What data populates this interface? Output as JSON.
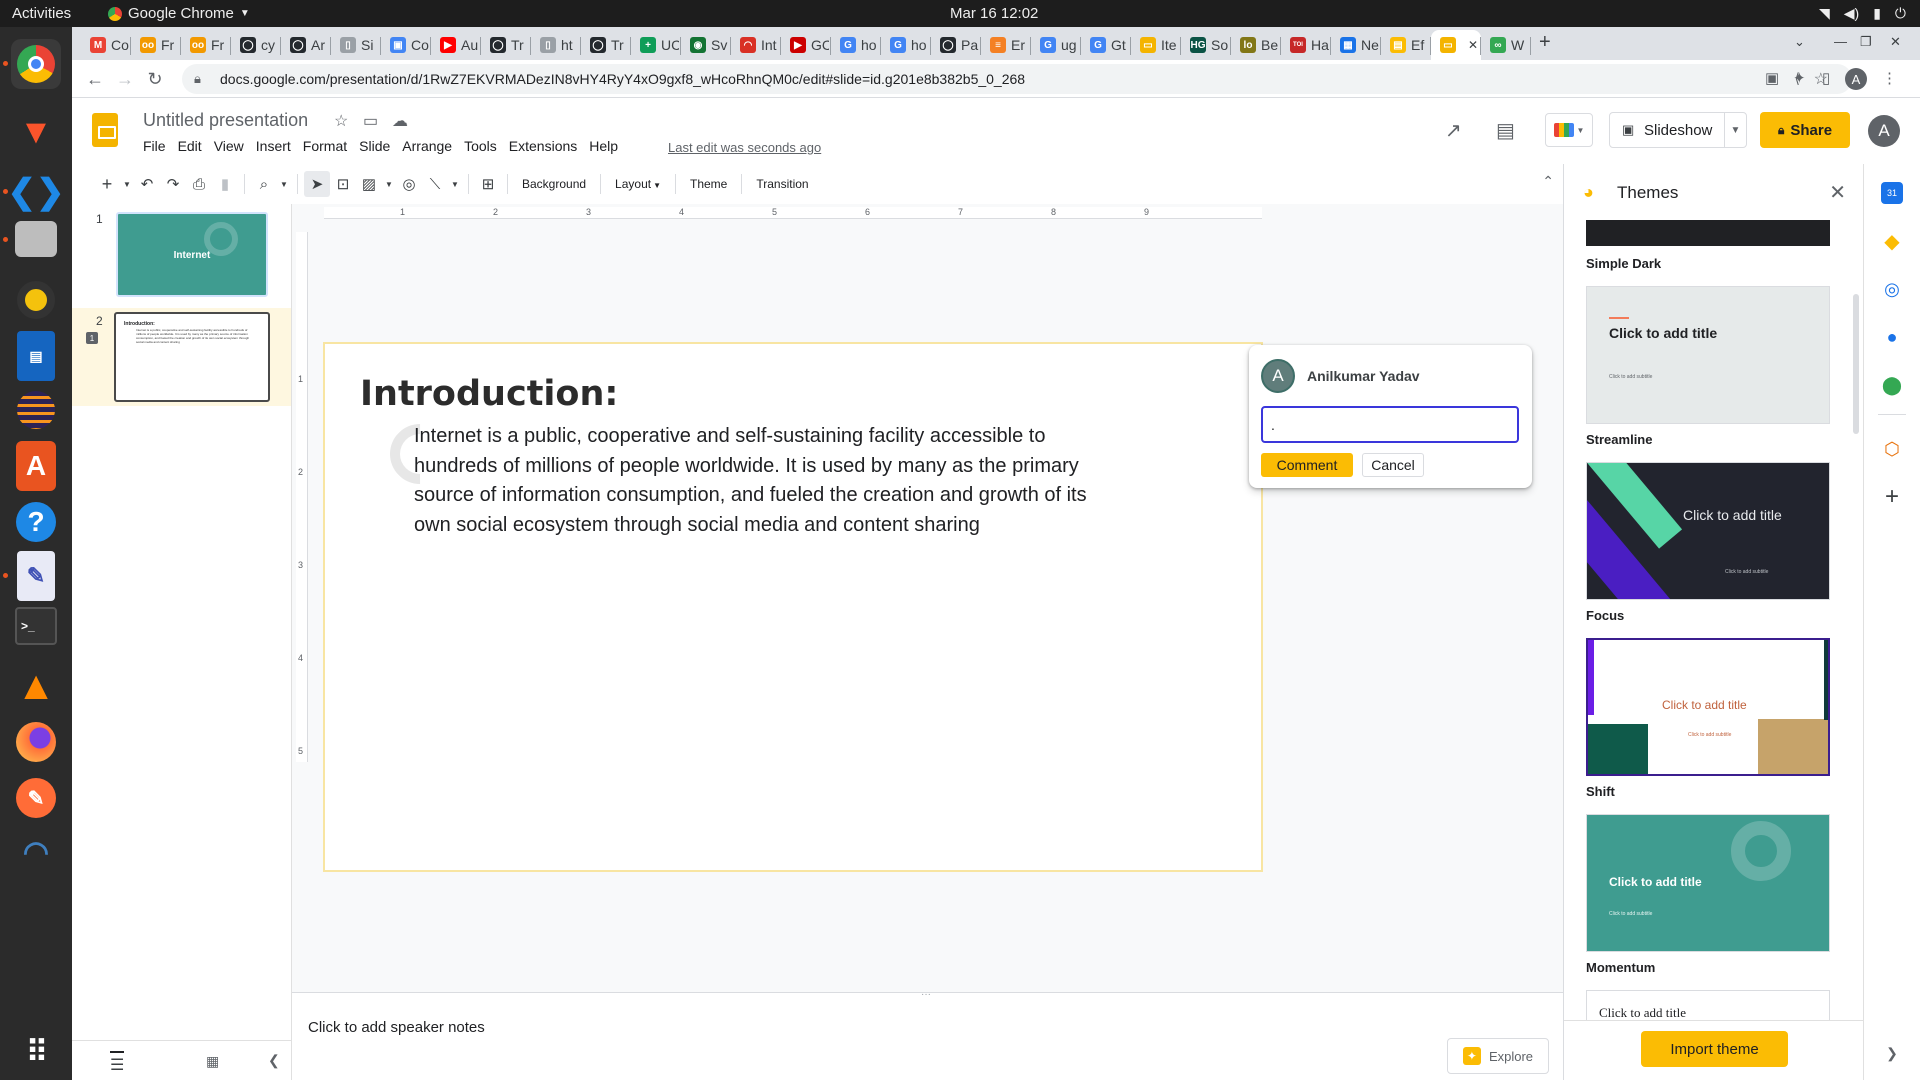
{
  "os": {
    "activities": "Activities",
    "app_name": "Google Chrome",
    "clock": "Mar 16  12:02"
  },
  "browser": {
    "tabs": [
      {
        "label": "Co",
        "favicon": "gmail-icon",
        "color": "#ea4335",
        "glyph": "M"
      },
      {
        "label": "Fr",
        "favicon": "link-icon",
        "color": "#f29900",
        "glyph": "oo"
      },
      {
        "label": "Fr",
        "favicon": "link-icon",
        "color": "#f29900",
        "glyph": "oo"
      },
      {
        "label": "cy",
        "favicon": "github-icon",
        "color": "#24292e",
        "glyph": "◯"
      },
      {
        "label": "Ar",
        "favicon": "github-icon",
        "color": "#24292e",
        "glyph": "◯"
      },
      {
        "label": "Si",
        "favicon": "doc-icon",
        "color": "#9aa0a6",
        "glyph": "▯"
      },
      {
        "label": "Co",
        "favicon": "calendar-icon",
        "color": "#4285f4",
        "glyph": "▣"
      },
      {
        "label": "Au",
        "favicon": "youtube-icon",
        "color": "#ff0000",
        "glyph": "▶"
      },
      {
        "label": "Tr",
        "favicon": "github-icon",
        "color": "#24292e",
        "glyph": "◯"
      },
      {
        "label": "ht",
        "favicon": "doc-icon",
        "color": "#9aa0a6",
        "glyph": "▯"
      },
      {
        "label": "Tr",
        "favicon": "github-icon",
        "color": "#24292e",
        "glyph": "◯"
      },
      {
        "label": "UC",
        "favicon": "sheets-icon",
        "color": "#0f9d58",
        "glyph": "+"
      },
      {
        "label": "Sv",
        "favicon": "globe-icon",
        "color": "#137333",
        "glyph": "◉"
      },
      {
        "label": "Int",
        "favicon": "speed-icon",
        "color": "#d93025",
        "glyph": "◠"
      },
      {
        "label": "GC",
        "favicon": "youtube-icon",
        "color": "#cc0000",
        "glyph": "▶"
      },
      {
        "label": "ho",
        "favicon": "google-icon",
        "color": "#4285f4",
        "glyph": "G"
      },
      {
        "label": "ho",
        "favicon": "google-icon",
        "color": "#4285f4",
        "glyph": "G"
      },
      {
        "label": "Pa",
        "favicon": "github-icon",
        "color": "#24292e",
        "glyph": "◯"
      },
      {
        "label": "Er",
        "favicon": "stackoverflow-icon",
        "color": "#f48024",
        "glyph": "≡"
      },
      {
        "label": "ug",
        "favicon": "google-icon",
        "color": "#4285f4",
        "glyph": "G"
      },
      {
        "label": "Gt",
        "favicon": "google-icon",
        "color": "#4285f4",
        "glyph": "G"
      },
      {
        "label": "Ite",
        "favicon": "slides-icon",
        "color": "#f4b400",
        "glyph": "▭"
      },
      {
        "label": "So",
        "favicon": "hg-icon",
        "color": "#0b5345",
        "glyph": "HG"
      },
      {
        "label": "Be",
        "favicon": "loop-icon",
        "color": "#827717",
        "glyph": "lo"
      },
      {
        "label": "Ha",
        "favicon": "toi-icon",
        "color": "#c62828",
        "glyph": "TOI"
      },
      {
        "label": "Ne",
        "favicon": "news-icon",
        "color": "#1a73e8",
        "glyph": "▦"
      },
      {
        "label": "Ef",
        "favicon": "page-icon",
        "color": "#fbbc04",
        "glyph": "▤"
      },
      {
        "label": "",
        "favicon": "slides-icon",
        "color": "#f4b400",
        "glyph": "▭",
        "active": true
      },
      {
        "label": "W",
        "favicon": "chain-icon",
        "color": "#34a853",
        "glyph": "∞"
      }
    ],
    "url": "docs.google.com/presentation/d/1RwZ7EKVRMADezIN8vHY4RyY4xO9gxf8_wHcoRhnQM0c/edit#slide=id.g201e8b382b5_0_268",
    "profile_initial": "A"
  },
  "doc": {
    "title": "Untitled presentation",
    "menus": [
      "File",
      "Edit",
      "View",
      "Insert",
      "Format",
      "Slide",
      "Arrange",
      "Tools",
      "Extensions",
      "Help"
    ],
    "last_edit": "Last edit was seconds ago",
    "slideshow": "Slideshow",
    "share": "Share",
    "avatar_initial": "A"
  },
  "toolbar": {
    "background": "Background",
    "layout": "Layout",
    "theme": "Theme",
    "transition": "Transition"
  },
  "filmstrip": {
    "slides": [
      {
        "number": "1",
        "title": "Internet"
      },
      {
        "number": "2",
        "title": "Introduction:"
      }
    ],
    "thumb2_body": "Internet is a public, cooperative and self-sustaining facility accessible to hundreds of millions of people worldwide. It is used by many as the primary source of information consumption, and fueled the creation and growth of its own social ecosystem through social media and content sharing"
  },
  "ruler": {
    "h_marks": [
      "1",
      "2",
      "3",
      "4",
      "5",
      "6",
      "7",
      "8",
      "9"
    ],
    "v_marks": [
      "1",
      "2",
      "3",
      "4",
      "5"
    ]
  },
  "slide": {
    "title": "Introduction:",
    "body": "Internet is a public, cooperative and self-sustaining facility accessible to hundreds of millions of people worldwide. It is used by many as the primary source of information consumption, and fueled the creation and growth of its own social ecosystem through social media and content sharing"
  },
  "comment": {
    "author": "Anilkumar Yadav",
    "author_initial": "A",
    "input_value": ".",
    "submit": "Comment",
    "cancel": "Cancel"
  },
  "notes": {
    "placeholder": "Click to add speaker notes",
    "explore": "Explore"
  },
  "themes_panel": {
    "title": "Themes",
    "themes": [
      {
        "name": "Simple Dark",
        "preview_title": ""
      },
      {
        "name": "Streamline",
        "preview_title": "Click to add title",
        "preview_subtitle": "Click to add subtitle"
      },
      {
        "name": "Focus",
        "preview_title": "Click to add title",
        "preview_subtitle": "Click to add subtitle"
      },
      {
        "name": "Shift",
        "preview_title": "Click to add title",
        "preview_subtitle": "Click to add subtitle"
      },
      {
        "name": "Momentum",
        "preview_title": "Click to add title",
        "preview_subtitle": "Click to add subtitle"
      },
      {
        "name": "",
        "preview_title": "Click to add title"
      }
    ],
    "import": "Import theme"
  },
  "colors": {
    "accent_yellow": "#fbbc04",
    "teal": "#3f9c90",
    "focus_blue": "#3a36db"
  }
}
